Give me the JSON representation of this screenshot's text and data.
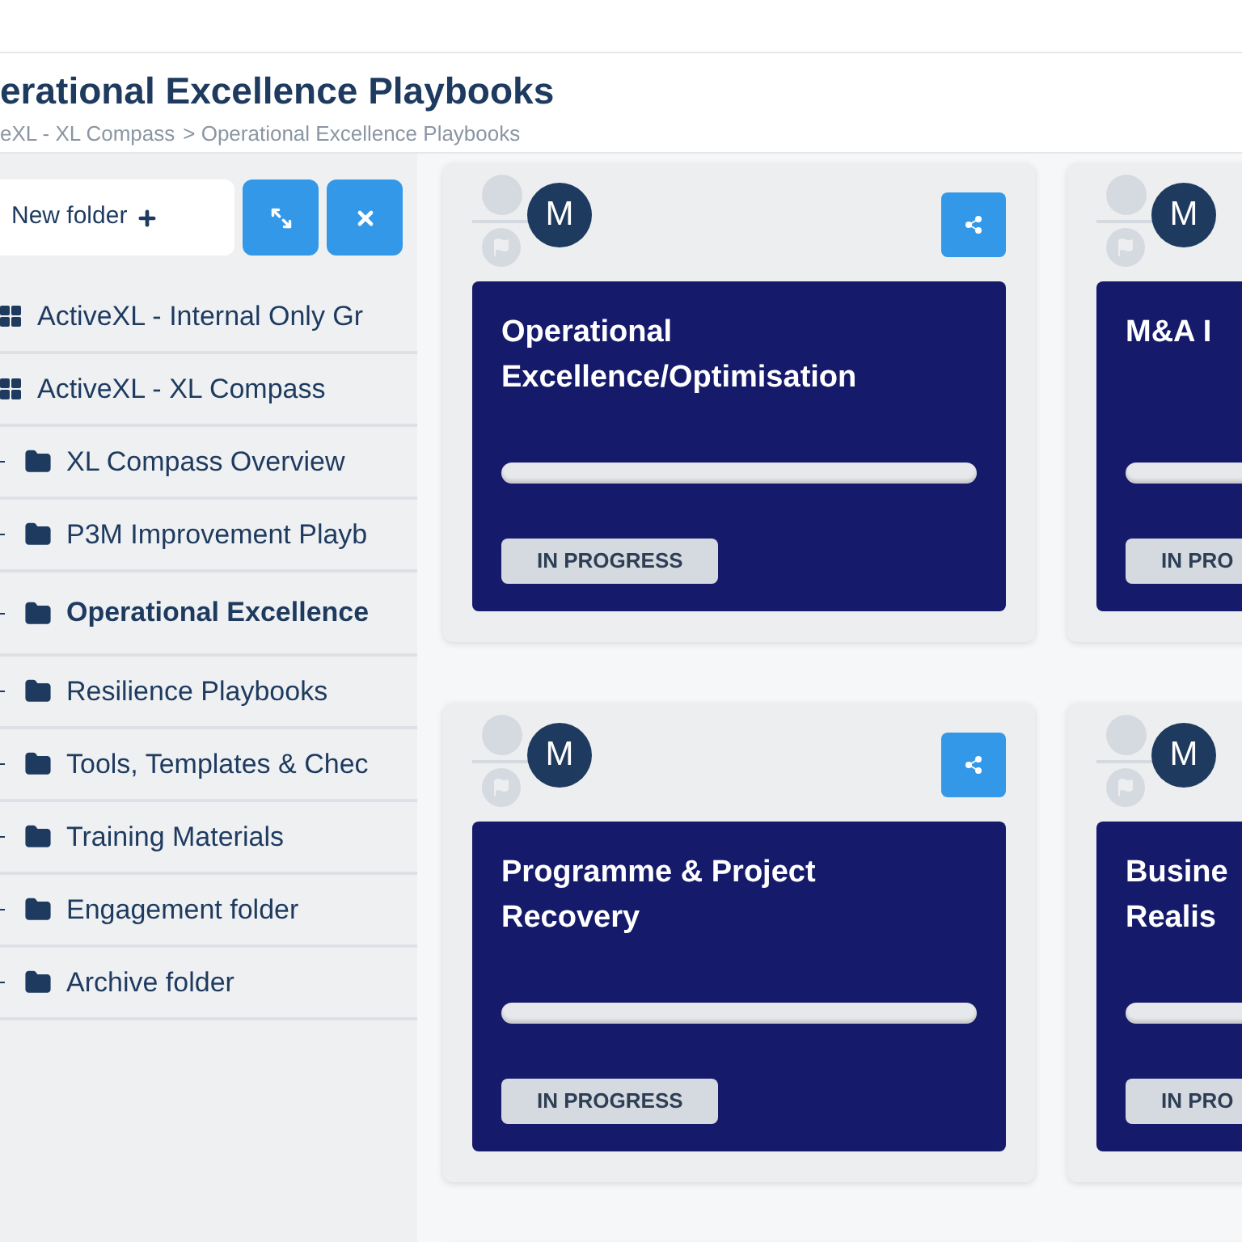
{
  "header": {
    "title": "erational Excellence Playbooks",
    "breadcrumb": [
      "eXL - XL Compass",
      "> Operational Excellence Playbooks"
    ]
  },
  "sidebar": {
    "new_folder": "New folder",
    "items": [
      {
        "label": "ActiveXL - Internal Only Gr",
        "kind": "group",
        "selected": false
      },
      {
        "label": "ActiveXL - XL Compass",
        "kind": "group",
        "selected": false
      },
      {
        "label": "XL Compass Overview",
        "kind": "folder",
        "selected": false
      },
      {
        "label": "P3M Improvement Playb",
        "kind": "folder",
        "selected": false
      },
      {
        "label": "Operational Excellence",
        "kind": "folder",
        "selected": true
      },
      {
        "label": "Resilience Playbooks",
        "kind": "folder",
        "selected": false
      },
      {
        "label": "Tools, Templates & Chec",
        "kind": "folder",
        "selected": false
      },
      {
        "label": "Training Materials",
        "kind": "folder",
        "selected": false
      },
      {
        "label": "Engagement folder",
        "kind": "folder",
        "selected": false
      },
      {
        "label": "Archive folder",
        "kind": "folder",
        "selected": false
      }
    ]
  },
  "cards": [
    {
      "avatar": "M",
      "title": [
        "Operational",
        "Excellence/Optimisation"
      ],
      "level": 0,
      "status": "IN PROGRESS"
    },
    {
      "avatar": "M",
      "title": [
        "M&A I"
      ],
      "level": 0,
      "status": "IN PRO"
    },
    {
      "avatar": "M",
      "title": [
        "Programme & Project",
        "Recovery"
      ],
      "level": 0,
      "status": "IN PROGRESS"
    },
    {
      "avatar": "M",
      "title": [
        "Busine",
        "Realis"
      ],
      "level": 0,
      "status": "IN PRO"
    }
  ]
}
